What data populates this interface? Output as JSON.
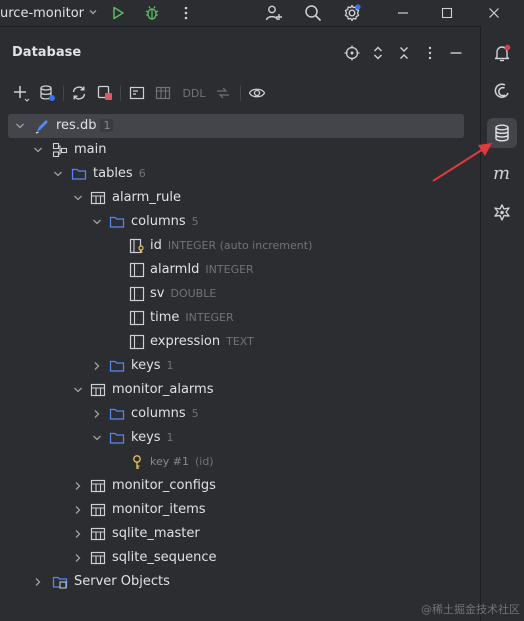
{
  "titlebar": {
    "project_name": "urce-monitor",
    "icons": [
      "chevron-down-icon",
      "run-icon",
      "debug-icon",
      "more-vertical-icon",
      "add-user-icon",
      "search-icon",
      "settings-icon",
      "minimize-icon",
      "maximize-icon",
      "close-icon"
    ]
  },
  "panel": {
    "title": "Database",
    "header_icons": [
      "target-icon",
      "expand-collapse-icon",
      "collapse-all-icon",
      "more-vertical-icon",
      "minimize-icon"
    ],
    "toolbar": {
      "ddl_label": "DDL",
      "icons": [
        "add-icon",
        "datasource-properties-icon",
        "refresh-icon",
        "stop-icon",
        "jump-to-console-icon",
        "table-icon",
        "ddl-icon",
        "compare-icon",
        "view-icon"
      ]
    }
  },
  "tree": {
    "root": {
      "label": "res.db",
      "count": "1"
    },
    "main": {
      "label": "main"
    },
    "tables": {
      "label": "tables",
      "count": "6"
    },
    "alarm_rule": {
      "label": "alarm_rule",
      "columns": {
        "label": "columns",
        "count": "5"
      },
      "fields": [
        {
          "name": "id",
          "type": "INTEGER (auto increment)"
        },
        {
          "name": "alarmId",
          "type": "INTEGER"
        },
        {
          "name": "sv",
          "type": "DOUBLE"
        },
        {
          "name": "time",
          "type": "INTEGER"
        },
        {
          "name": "expression",
          "type": "TEXT"
        }
      ],
      "keys": {
        "label": "keys",
        "count": "1"
      }
    },
    "monitor_alarms": {
      "label": "monitor_alarms",
      "columns": {
        "label": "columns",
        "count": "5"
      },
      "keys": {
        "label": "keys",
        "count": "1"
      },
      "key_item": {
        "label": "key #1",
        "detail": "(id)"
      }
    },
    "other_tables": [
      "monitor_configs",
      "monitor_items",
      "sqlite_master",
      "sqlite_sequence"
    ],
    "server_objects": {
      "label": "Server Objects"
    }
  },
  "right_strip": {
    "icons": [
      "notifications-icon",
      "ai-assistant-icon",
      "database-icon",
      "m-plugin-icon",
      "settings-sync-icon"
    ]
  },
  "watermark": "@稀土掘金技术社区",
  "colors": {
    "background": "#2b2d30",
    "selection": "#43454a",
    "folder": "#548af7",
    "accent_green": "#5fb865",
    "annotation": "#e0393e",
    "key": "#e8c25a"
  }
}
